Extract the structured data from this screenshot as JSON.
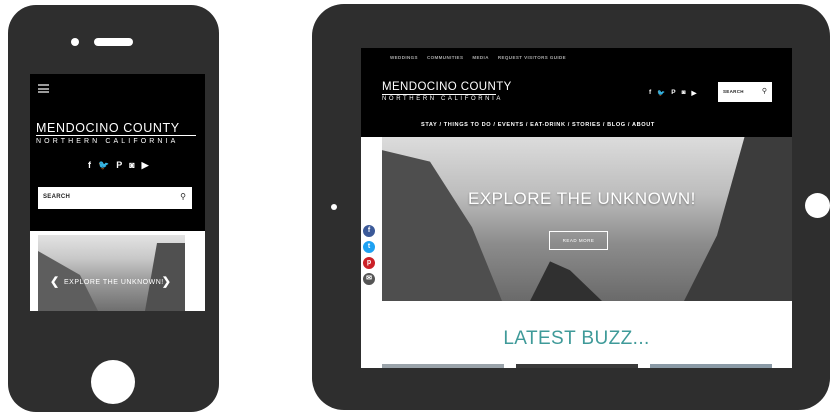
{
  "phone": {
    "logo_line1": "MENDOCINO COUNTY",
    "logo_line2": "NORTHERN CALIFORNIA",
    "social_icons": [
      "f",
      "🐦",
      "P",
      "◙",
      "▶"
    ],
    "search_placeholder": "SEARCH",
    "hero_text": "EXPLORE THE UNKNOWN!"
  },
  "tablet": {
    "top_nav": [
      "WEDDINGS",
      "COMMUNITIES",
      "MEDIA",
      "REQUEST VISITORS GUIDE"
    ],
    "logo_line1": "MENDOCINO COUNTY",
    "logo_line2": "NORTHERN CALIFORNIA",
    "social_icons": [
      "f",
      "🐦",
      "P",
      "◙",
      "▶"
    ],
    "search_placeholder": "SEARCH",
    "main_nav": "STAY / THINGS TO DO / EVENTS / EAT-DRINK / STORIES / BLOG / ABOUT",
    "hero_title": "EXPLORE THE UNKNOWN!",
    "hero_button": "READ MORE",
    "section_title": "LATEST BUZZ...",
    "share_icons": [
      "f",
      "t",
      "p",
      "✉"
    ]
  },
  "colors": {
    "device": "#2e2e2e",
    "accent_teal": "#3f9a99",
    "share_facebook": "#3b5998",
    "share_twitter": "#1da1f2",
    "share_pinterest": "#cb2027",
    "share_email": "#555555"
  }
}
